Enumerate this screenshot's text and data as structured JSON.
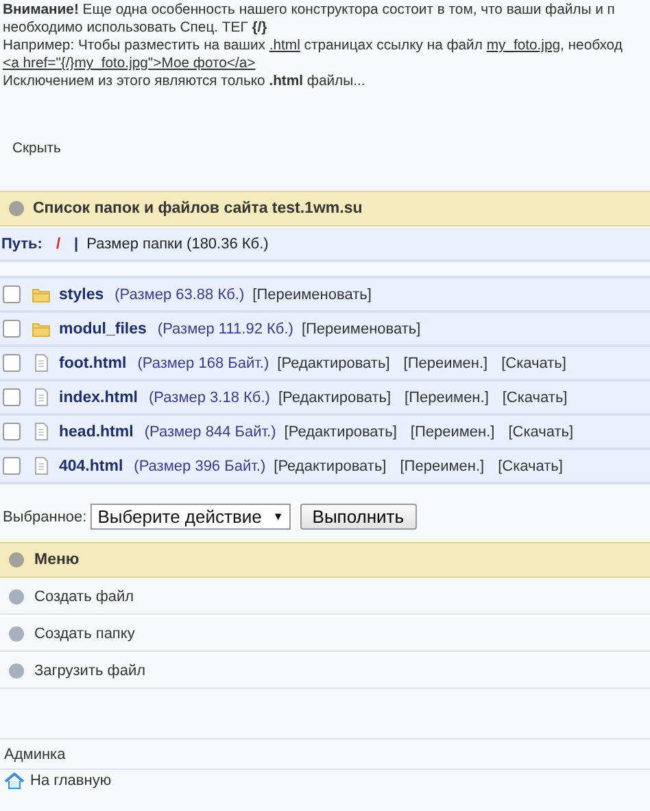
{
  "notice": {
    "lines": [
      [
        {
          "kind": "text",
          "text": "**Внимание!** Еще одна особенность нашего конструктора состоит в том, что ваши файлы и п"
        }
      ],
      [
        {
          "kind": "text",
          "text": "необходимо использовать Спец. ТЕГ **{/}**"
        }
      ],
      [
        {
          "kind": "text",
          "text": "Например: Чтобы разместить на ваших "
        },
        {
          "kind": "link",
          "text": ".html"
        },
        {
          "kind": "text",
          "text": " страницах ссылку на файл "
        },
        {
          "kind": "link",
          "text": "my_foto.jpg"
        },
        {
          "kind": "text",
          "text": ", необход"
        }
      ],
      [
        {
          "kind": "link",
          "text": "<a href=\"{/}my_foto.jpg\">Мое фото</a>"
        }
      ],
      [
        {
          "kind": "text",
          "text": "Исключением из этого являются только **.html** файлы..."
        }
      ]
    ],
    "hide_link": "Скрыть"
  },
  "files_panel": {
    "title": "Список папок и файлов сайта test.1wm.su",
    "path_label": "Путь:",
    "path_root": "/",
    "separator": "|",
    "folder_size": "Размер папки (180.36 Кб.)",
    "items": [
      {
        "kind": "folder",
        "name": "styles",
        "size": "(Размер 63.88 Кб.)",
        "actions": [
          "[Переименовать]"
        ],
        "checked": false
      },
      {
        "kind": "folder",
        "name": "modul_files",
        "size": "(Размер 111.92 Кб.)",
        "actions": [
          "[Переименовать]"
        ],
        "checked": false
      },
      {
        "kind": "file",
        "name": "foot.html",
        "size": "(Размер 168 Байт.)",
        "actions": [
          "[Редактировать]",
          "[Переимен.]",
          "[Скачать]"
        ],
        "checked": false
      },
      {
        "kind": "file",
        "name": "index.html",
        "size": "(Размер 3.18 Кб.)",
        "actions": [
          "[Редактировать]",
          "[Переимен.]",
          "[Скачать]"
        ],
        "checked": false
      },
      {
        "kind": "file",
        "name": "head.html",
        "size": "(Размер 844 Байт.)",
        "actions": [
          "[Редактировать]",
          "[Переимен.]",
          "[Скачать]"
        ],
        "checked": false
      },
      {
        "kind": "file",
        "name": "404.html",
        "size": "(Размер 396 Байт.)",
        "actions": [
          "[Редактировать]",
          "[Переимен.]",
          "[Скачать]"
        ],
        "checked": false
      }
    ],
    "selected_label": "Выбранное:",
    "action_select": "Выберите действие",
    "action_arrow": "▼",
    "run_button": "Выполнить"
  },
  "menu": {
    "title": "Меню",
    "items": [
      "Создать файл",
      "Создать папку",
      "Загрузить файл"
    ]
  },
  "admin": {
    "title": "Админка",
    "home_link": "На главную"
  }
}
